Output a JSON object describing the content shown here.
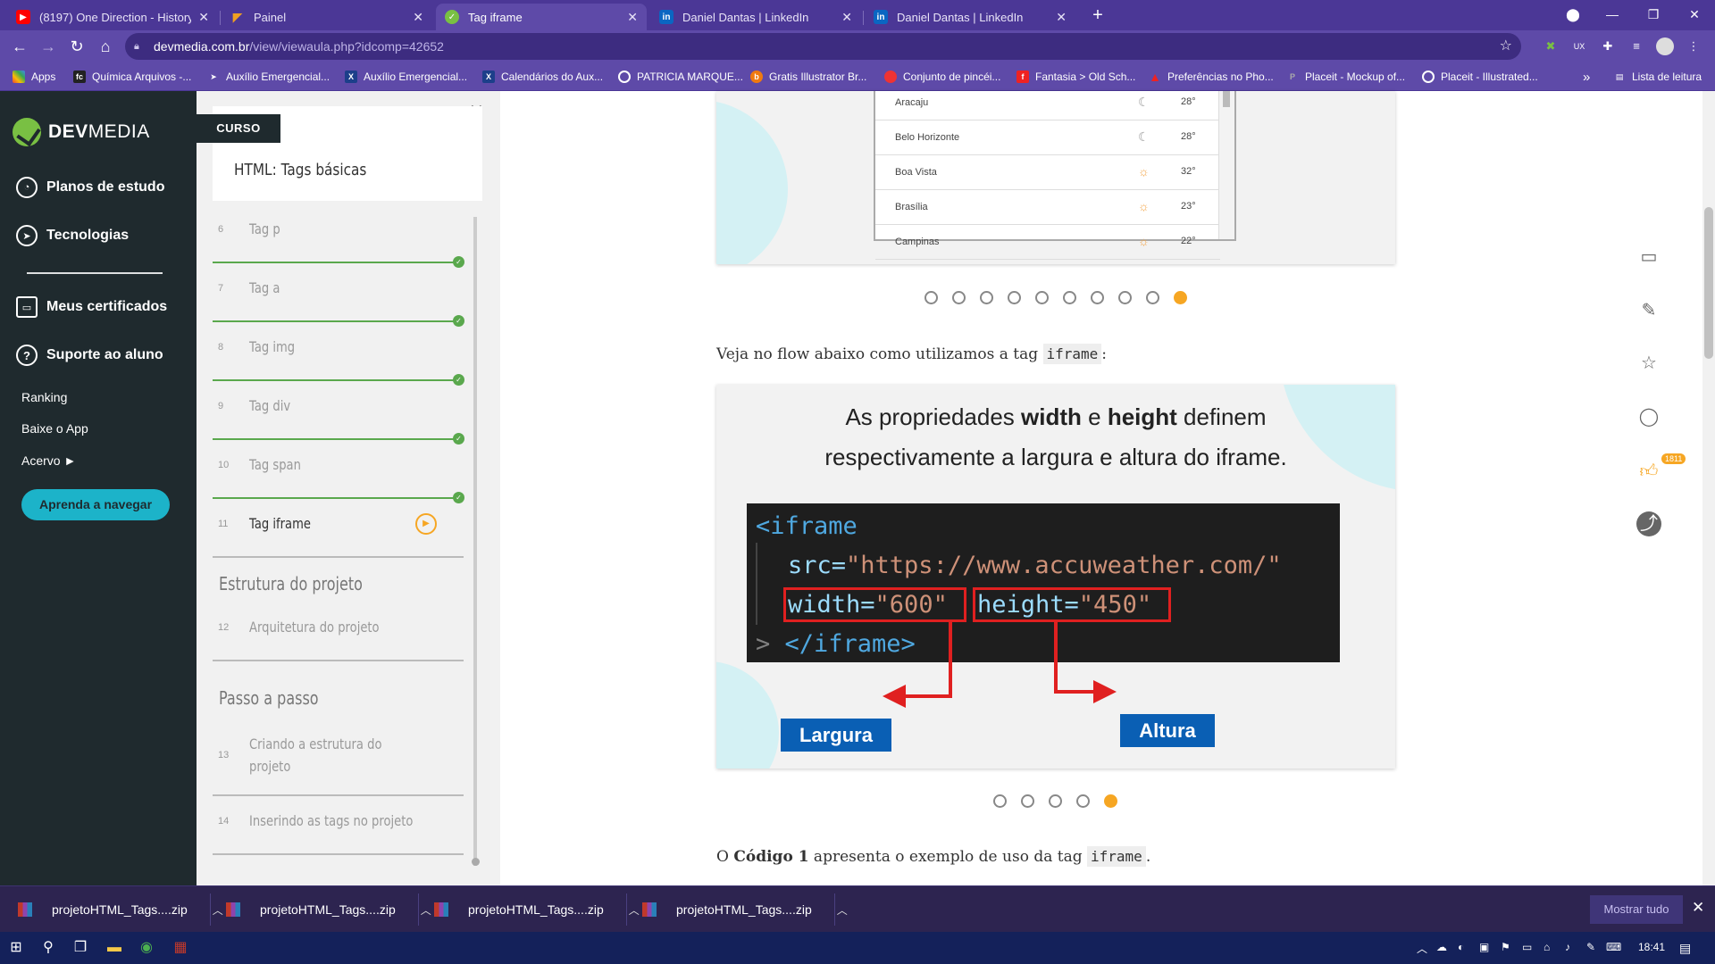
{
  "browser": {
    "tabs": [
      {
        "label": "(8197) One Direction - History (O",
        "icon": "youtube-icon",
        "color": "#ff0000"
      },
      {
        "label": "Painel",
        "icon": "painel-icon",
        "color": "#f0a020"
      },
      {
        "label": "Tag iframe",
        "icon": "devmedia-icon",
        "color": "#79c043"
      },
      {
        "label": "Daniel Dantas | LinkedIn",
        "icon": "linkedin-icon",
        "color": "#0a66c2"
      },
      {
        "label": "Daniel Dantas | LinkedIn",
        "icon": "linkedin-icon",
        "color": "#0a66c2"
      }
    ],
    "url_host": "devmedia.com.br",
    "url_path": "/view/viewaula.php?idcomp=42652",
    "bookmarks": [
      "Apps",
      "Química Arquivos -...",
      "Auxílio Emergencial...",
      "Auxílio Emergencial...",
      "Calendários do Aux...",
      "PATRICIA MARQUE...",
      "Gratis Illustrator Br...",
      "Conjunto de pincéi...",
      "Fantasia > Old Sch...",
      "Preferências no Pho...",
      "Placeit - Mockup of...",
      "Placeit - Illustrated..."
    ],
    "bookmarks_more": "»",
    "reading_list": "Lista de leitura"
  },
  "leftnav": {
    "logo_a": "DEV",
    "logo_b": "MEDIA",
    "items": [
      "Planos de estudo",
      "Tecnologias",
      "Meus certificados",
      "Suporte ao aluno"
    ],
    "small_items": [
      "Ranking",
      "Baixe o App",
      "Acervo ►"
    ],
    "cta": "Aprenda a navegar"
  },
  "course": {
    "badge": "CURSO",
    "title": "HTML: Tags básicas",
    "lessons": [
      {
        "num": "6",
        "name": "Tag p"
      },
      {
        "num": "7",
        "name": "Tag a"
      },
      {
        "num": "8",
        "name": "Tag img"
      },
      {
        "num": "9",
        "name": "Tag div"
      },
      {
        "num": "10",
        "name": "Tag span"
      },
      {
        "num": "11",
        "name": "Tag iframe"
      }
    ],
    "sections": [
      {
        "title": "Estrutura do projeto",
        "lessons": [
          {
            "num": "12",
            "name": "Arquitetura do projeto"
          }
        ]
      },
      {
        "title": "Passo a passo",
        "lessons": [
          {
            "num": "13",
            "name_line1": "Criando a estrutura do",
            "name_line2": "projeto"
          },
          {
            "num": "14",
            "name": "Inserindo as tags no projeto"
          }
        ]
      }
    ]
  },
  "main": {
    "cities": [
      {
        "name": "Aracaju",
        "temp": "28°"
      },
      {
        "name": "Belo Horizonte",
        "temp": "28°"
      },
      {
        "name": "Boa Vista",
        "temp": "32°"
      },
      {
        "name": "Brasília",
        "temp": "23°"
      },
      {
        "name": "Campinas",
        "temp": "22°"
      }
    ],
    "para1_text": "Veja no flow abaixo como utilizamos a tag ",
    "para1_code": "iframe",
    "para1_end": ":",
    "caption_1": "As propriedades ",
    "caption_w": "width",
    "caption_e": " e ",
    "caption_h": "height",
    "caption_2": " definem",
    "caption_3": "respectivamente a largura e altura do iframe.",
    "code_line1": "<iframe",
    "code_src_attr": "src=",
    "code_src_val": "\"https://www.accuweather.com/\"",
    "code_width": "width=",
    "code_width_val": "\"600\"",
    "code_height": "height=",
    "code_height_val": "\"450\"",
    "code_close": "</iframe>",
    "label_largura": "Largura",
    "label_altura": "Altura",
    "para2_a": "O ",
    "para2_b": "Código 1",
    "para2_c": " apresenta o exemplo de uso da tag ",
    "para2_code": "iframe",
    "para2_end": ".",
    "likes": "1811"
  },
  "downloads": {
    "items": [
      "projetoHTML_Tags....zip",
      "projetoHTML_Tags....zip",
      "projetoHTML_Tags....zip",
      "projetoHTML_Tags....zip"
    ],
    "show_all": "Mostrar tudo"
  },
  "taskbar": {
    "time": "18:41"
  }
}
